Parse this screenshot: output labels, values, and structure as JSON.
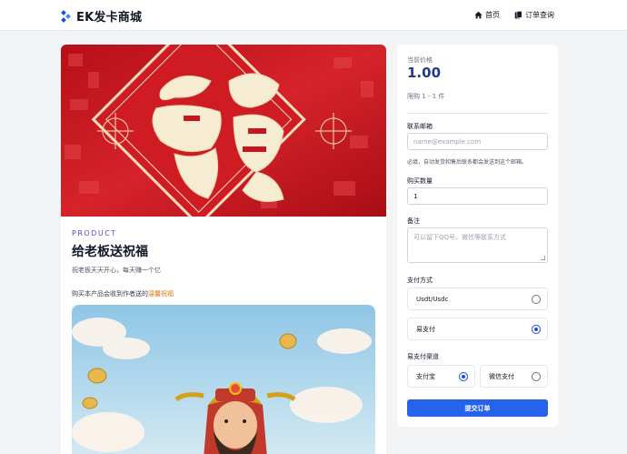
{
  "header": {
    "brand_name": "EK发卡商城",
    "nav": [
      {
        "label": "首页",
        "icon": "home-icon"
      },
      {
        "label": "订单查询",
        "icon": "orders-icon"
      }
    ]
  },
  "product": {
    "tag": "PRODUCT",
    "title": "给老板送祝福",
    "subtitle": "祝老板天天开心，每天赚一个亿",
    "note_prefix": "购买本产品会收到作者送的",
    "note_highlight": "温馨祝福",
    "banner_char": "福"
  },
  "order": {
    "price_label": "当前价格",
    "price_value": "1.00",
    "limit": "限购 1 - 1 件",
    "email": {
      "label": "联系邮箱",
      "placeholder": "name@example.com",
      "hint": "必填，自动发货和售后联系都会发送到这个邮箱。"
    },
    "quantity": {
      "label": "购买数量",
      "value": "1"
    },
    "remark": {
      "label": "备注",
      "placeholder": "可以留下QQ号、微信等联系方式"
    },
    "payment": {
      "label": "支付方式",
      "options": [
        {
          "label": "Usdt/Usdc",
          "selected": false
        },
        {
          "label": "易支付",
          "selected": true
        }
      ]
    },
    "channel": {
      "label": "易支付渠道",
      "options": [
        {
          "label": "支付宝",
          "selected": true
        },
        {
          "label": "微信支付",
          "selected": false
        }
      ]
    },
    "submit_label": "提交订单"
  },
  "colors": {
    "accent": "#2563eb",
    "price": "#1e3a8a",
    "tag": "#4f46e5",
    "highlight": "#d97706",
    "banner_red": "#c8141c"
  }
}
